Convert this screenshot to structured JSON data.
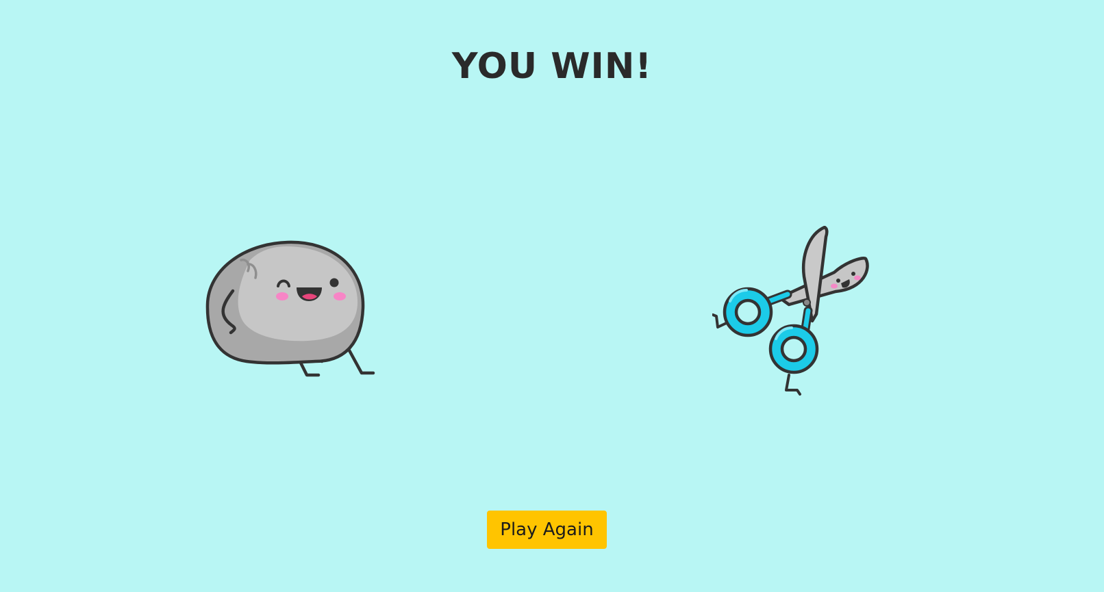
{
  "result": {
    "title": "YOU WIN!"
  },
  "player_choice": {
    "name": "rock",
    "icon": "rock-character-icon"
  },
  "computer_choice": {
    "name": "scissors",
    "icon": "scissors-character-icon"
  },
  "actions": {
    "play_again_label": "Play Again"
  },
  "colors": {
    "background": "#b8f6f4",
    "button": "#ffc400",
    "scissors_handle": "#1ccbe8",
    "rock": "#c6c6c6"
  }
}
